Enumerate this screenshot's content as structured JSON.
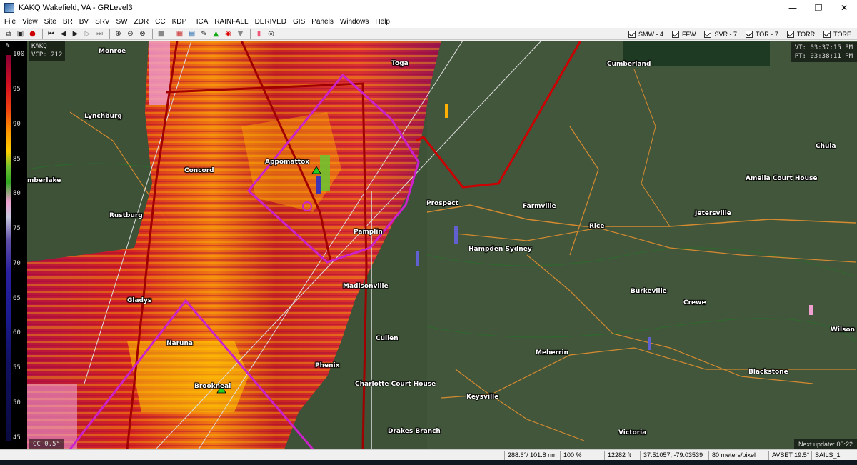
{
  "window": {
    "title": "KAKQ Wakefield, VA - GRLevel3",
    "minimize": "—",
    "maximize": "❐",
    "close": "✕"
  },
  "menu": [
    "File",
    "View",
    "Site",
    "BR",
    "BV",
    "SRV",
    "SW",
    "ZDR",
    "CC",
    "KDP",
    "HCA",
    "RAINFALL",
    "DERIVED",
    "GIS",
    "Panels",
    "Windows",
    "Help"
  ],
  "toolbar": {
    "buttons": [
      "copy-icon",
      "paste-icon",
      "record-icon",
      "first-frame-icon",
      "prev-frame-icon",
      "play-icon",
      "next-frame-icon",
      "last-frame-icon",
      "zoom-in-icon",
      "zoom-out-icon",
      "zoom-reset-icon",
      "stop-icon",
      "color-table-icon",
      "layers-icon",
      "tools-icon",
      "triangle-icon",
      "circle-icon",
      "shield-icon",
      "palette-icon",
      "settings-icon"
    ],
    "warnings": [
      {
        "label": "SMW - 4",
        "checked": true
      },
      {
        "label": "FFW",
        "checked": true
      },
      {
        "label": "SVR - 7",
        "checked": true
      },
      {
        "label": "TOR - 7",
        "checked": true
      },
      {
        "label": "TORR",
        "checked": true
      },
      {
        "label": "TORE",
        "checked": true
      }
    ]
  },
  "legend": {
    "unit": "%",
    "ticks": [
      "100",
      "95",
      "90",
      "85",
      "80",
      "75",
      "70",
      "65",
      "60",
      "55",
      "50",
      "45"
    ]
  },
  "overlay": {
    "site": "KAKQ",
    "vcp": "VCP: 212",
    "vt": "VT: 03:37:15 PM",
    "pt": "PT: 03:38:11 PM",
    "product": "CC 0.5°",
    "next_update": "Next update: 00:22"
  },
  "cities": [
    {
      "name": "Monroe",
      "key": "monroe"
    },
    {
      "name": "Toga",
      "key": "toga"
    },
    {
      "name": "Cumberland",
      "key": "cumberland"
    },
    {
      "name": "Lynchburg",
      "key": "lynchburg"
    },
    {
      "name": "Chula",
      "key": "chula"
    },
    {
      "name": "Appomattox",
      "key": "appomattox"
    },
    {
      "name": "Concord",
      "key": "concord"
    },
    {
      "name": "Amelia Court House",
      "key": "amelia"
    },
    {
      "name": "mberlake",
      "key": "timberlake"
    },
    {
      "name": "Prospect",
      "key": "prospect"
    },
    {
      "name": "Farmville",
      "key": "farmville"
    },
    {
      "name": "Jetersville",
      "key": "jetersville"
    },
    {
      "name": "Rustburg",
      "key": "rustburg"
    },
    {
      "name": "Rice",
      "key": "rice"
    },
    {
      "name": "Pamplin",
      "key": "pamplin"
    },
    {
      "name": "Hampden Sydney",
      "key": "hampden"
    },
    {
      "name": "Madisonville",
      "key": "madisonville"
    },
    {
      "name": "Burkeville",
      "key": "burkeville"
    },
    {
      "name": "Gladys",
      "key": "gladys"
    },
    {
      "name": "Crewe",
      "key": "crewe"
    },
    {
      "name": "Wilson",
      "key": "wilson"
    },
    {
      "name": "Cullen",
      "key": "cullen"
    },
    {
      "name": "Naruna",
      "key": "naruna"
    },
    {
      "name": "Meherrin",
      "key": "meherrin"
    },
    {
      "name": "Phenix",
      "key": "phenix"
    },
    {
      "name": "Blackstone",
      "key": "blackstone"
    },
    {
      "name": "Brookneal",
      "key": "brookneal"
    },
    {
      "name": "Charlotte Court House",
      "key": "charlotte"
    },
    {
      "name": "Keysville",
      "key": "keysville"
    },
    {
      "name": "Drakes Branch",
      "key": "drakes"
    },
    {
      "name": "Victoria",
      "key": "victoria"
    }
  ],
  "status": {
    "azimuth": "288.6°/ 101.8 nm",
    "zoom": "100 %",
    "altitude": "12282 ft",
    "latlon": "37.51057, -79.03539",
    "resolution": "80 meters/pixel",
    "avset": "AVSET 19.5°",
    "sails": "SAILS_1"
  },
  "colors": {
    "warning_purple": "#cc22cc",
    "tornado_red": "#cc0000",
    "map_green": "#3d5236"
  }
}
